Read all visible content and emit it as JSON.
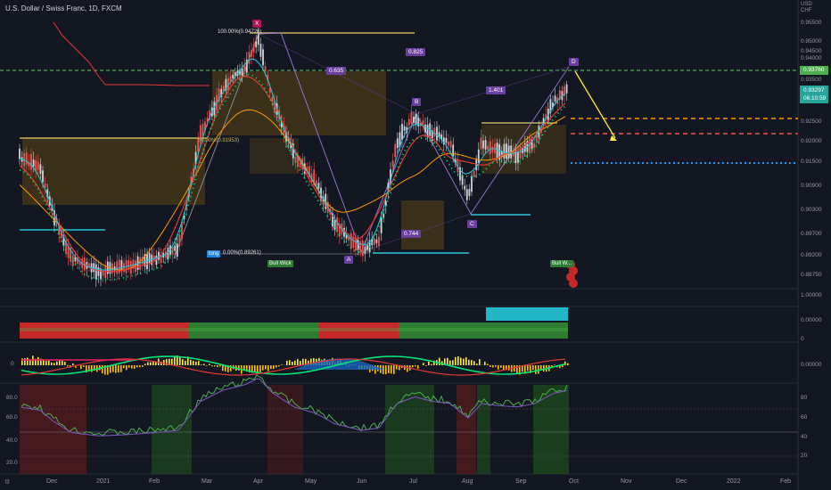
{
  "header": {
    "title": "U.S. Dollar / Swiss Franc, 1D, FXCM"
  },
  "currency": {
    "line1": "USD",
    "line2": "CHF"
  },
  "price_axis": {
    "main": [
      "0.95500",
      "0.95000",
      "0.94500",
      "0.94000",
      "0.93500",
      "0.92500",
      "0.92000",
      "0.91500",
      "0.90900",
      "0.90300",
      "0.89700",
      "0.89200",
      "0.88750"
    ],
    "osc1": [
      "1.00000",
      "0.00000",
      "0"
    ],
    "osc2": [
      "0.00000"
    ],
    "rsi_right": [
      "80",
      "60",
      "40",
      "20"
    ],
    "rsi_left": [
      "80.0",
      "60.0",
      "40.0",
      "20.0"
    ],
    "zero_left": "0",
    "current_price": "0.93297",
    "countdown": "06:10:59",
    "green_line_price": "0.93760"
  },
  "time_axis": [
    "Dec",
    "2021",
    "Feb",
    "Mar",
    "Apr",
    "May",
    "Jun",
    "Jul",
    "Aug",
    "Sep",
    "Oct",
    "Nov",
    "Dec",
    "2022",
    "Feb"
  ],
  "fib_labels": {
    "top": "100.00%(0.94726)",
    "mid": "50.00%(0.91953)",
    "bottom": "0.00%(0.89261)"
  },
  "pattern": {
    "X": "X",
    "A": "A",
    "B": "B",
    "C": "C",
    "D": "D",
    "ratio_xb": "0.635",
    "ratio_ac": "0.825",
    "ratio_bd": "1.401",
    "ratio_ab": "0.744"
  },
  "signals": {
    "long": "long",
    "bull_wick1": "Bull Wick",
    "bull_wick2": "Bull W..."
  },
  "colors": {
    "bg": "#131722",
    "up": "#e0e0e0",
    "down": "#ef5350",
    "green_line": "#4caf50",
    "orange_line": "#ff9800",
    "red_line": "#ef5350",
    "blue_line": "#2196f3",
    "label_bg": "#26a69a"
  }
}
